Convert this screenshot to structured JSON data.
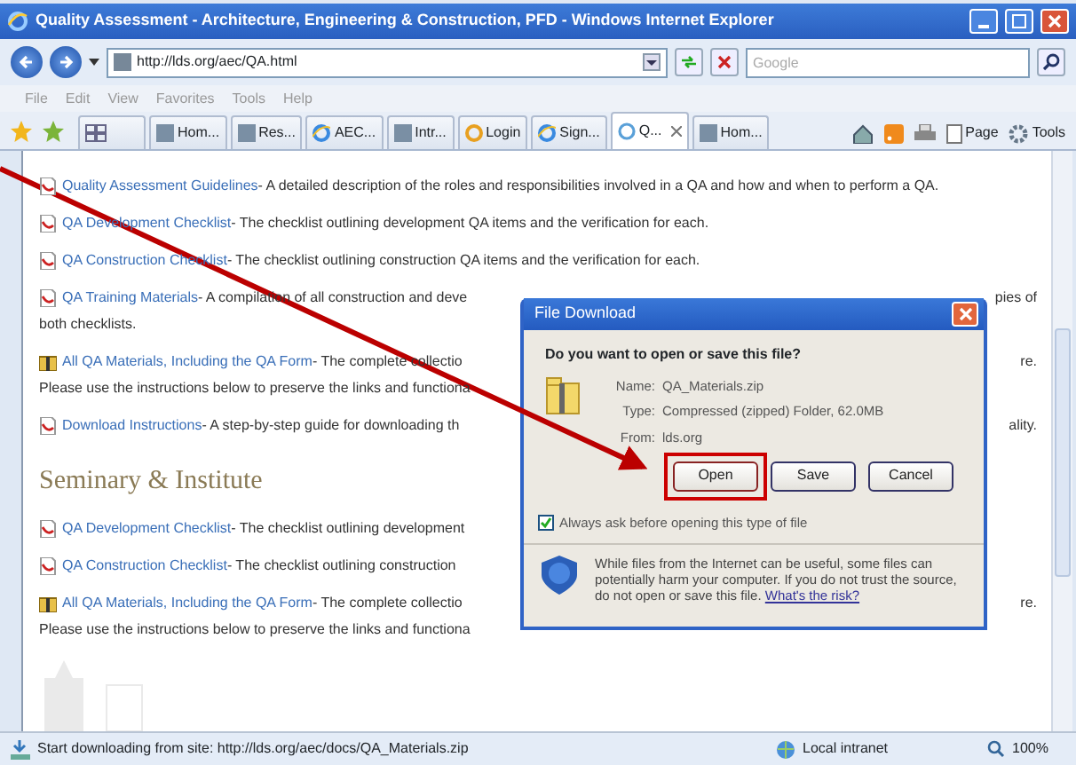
{
  "window": {
    "title": "Quality Assessment - Architecture, Engineering & Construction, PFD - Windows Internet Explorer"
  },
  "address_bar": {
    "url": "http://lds.org/aec/QA.html"
  },
  "search": {
    "placeholder": "Google"
  },
  "menu": [
    "File",
    "Edit",
    "View",
    "Favorites",
    "Tools",
    "Help"
  ],
  "tabs": [
    {
      "label": "Hom...",
      "selected": false
    },
    {
      "label": "Res...",
      "selected": false
    },
    {
      "label": "AEC...",
      "selected": false
    },
    {
      "label": "Intr...",
      "selected": false
    },
    {
      "label": "Login",
      "selected": false
    },
    {
      "label": "Sign...",
      "selected": false
    },
    {
      "label": "Q...",
      "selected": true
    },
    {
      "label": "Hom...",
      "selected": false
    }
  ],
  "command_bar": [
    "Page",
    "Tools"
  ],
  "sections": [
    {
      "items": [
        {
          "kind": "pdf",
          "link": "Quality Assessment Guidelines",
          "text": " - A detailed description of the roles and responsibilities involved in a QA and how and when to perform a QA."
        },
        {
          "kind": "pdf",
          "link": "QA Development Checklist",
          "text": " - The checklist outlining development QA items and the verification for each."
        },
        {
          "kind": "pdf",
          "link": "QA Construction Checklist",
          "text": " - The checklist outlining construction QA items and the verification for each."
        },
        {
          "kind": "pdf",
          "link": "QA Training Materials",
          "text": " - A compilation of all construction and deve",
          "text_right": "pies of",
          "continuation": "both checklists."
        },
        {
          "kind": "zip",
          "link": "All QA Materials, Including the QA Form",
          "text": " - The complete collectio",
          "text_right": "re.",
          "continuation": "Please use the instructions below to preserve the links and functiona"
        },
        {
          "kind": "pdf",
          "link": "Download Instructions",
          "text": " - A step-by-step guide for downloading th",
          "text_right": "ality."
        }
      ]
    },
    {
      "heading": "Seminary & Institute",
      "items": [
        {
          "kind": "pdf",
          "link": "QA Development Checklist",
          "text": " - The checklist outlining development"
        },
        {
          "kind": "pdf",
          "link": "QA Construction Checklist",
          "text": " - The checklist outlining construction"
        },
        {
          "kind": "zip",
          "link": "All QA Materials, Including the QA Form",
          "text": " - The complete collectio",
          "text_right": "re.",
          "continuation": "Please use the instructions below to preserve the links and functiona"
        }
      ]
    }
  ],
  "dialog": {
    "title": "File Download",
    "question": "Do you want to open or save this file?",
    "fields": [
      {
        "label": "Name:",
        "value": "QA_Materials.zip"
      },
      {
        "label": "Type:",
        "value": "Compressed (zipped) Folder, 62.0MB"
      },
      {
        "label": "From:",
        "value": "lds.org"
      }
    ],
    "buttons": [
      {
        "label": "Open",
        "highlighted": true
      },
      {
        "label": "Save",
        "highlighted": false
      },
      {
        "label": "Cancel",
        "highlighted": false
      }
    ],
    "always_ask": {
      "label": "Always ask before opening this type of file",
      "checked": true
    },
    "warning": "While files from the Internet can be useful, some files can potentially harm your computer. If you do not trust the source, do not open or save this file.",
    "risk_link": "What's the risk?"
  },
  "status_bar": {
    "text": "Start downloading from site: http://lds.org/aec/docs/QA_Materials.zip",
    "zone": "Local intranet",
    "zoom": "100%"
  }
}
